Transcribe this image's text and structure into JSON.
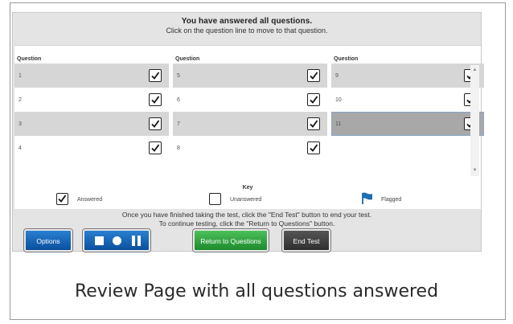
{
  "header": {
    "title": "You have answered all questions.",
    "subtitle": "Click on the question line to move to that question."
  },
  "columns": [
    {
      "header": "Question",
      "rows": [
        {
          "num": "1",
          "answered": true
        },
        {
          "num": "2",
          "answered": true
        },
        {
          "num": "3",
          "answered": true
        },
        {
          "num": "4",
          "answered": true
        }
      ]
    },
    {
      "header": "Question",
      "rows": [
        {
          "num": "5",
          "answered": true
        },
        {
          "num": "6",
          "answered": true
        },
        {
          "num": "7",
          "answered": true
        },
        {
          "num": "8",
          "answered": true
        }
      ]
    },
    {
      "header": "Question",
      "rows": [
        {
          "num": "9",
          "answered": true
        },
        {
          "num": "10",
          "answered": true
        },
        {
          "num": "11",
          "answered": true
        }
      ]
    }
  ],
  "current_question": "11",
  "key": {
    "title": "Key",
    "answered": "Answered",
    "unanswered": "Unanswered",
    "flagged": "Flagged"
  },
  "footer": {
    "line1": "Once you have finished taking the test, click the \"End Test\" button to end your test.",
    "line2": "To continue testing, click the \"Return to Questions\" button."
  },
  "buttons": {
    "options": "Options",
    "return": "Return to Questions",
    "end": "End Test"
  },
  "caption": "Review Page with all questions answered",
  "colors": {
    "blue_button": "#0b4f9e",
    "green_button": "#1e8a2e",
    "dark_button": "#2f2f2f",
    "flag": "#1a6fb5"
  }
}
